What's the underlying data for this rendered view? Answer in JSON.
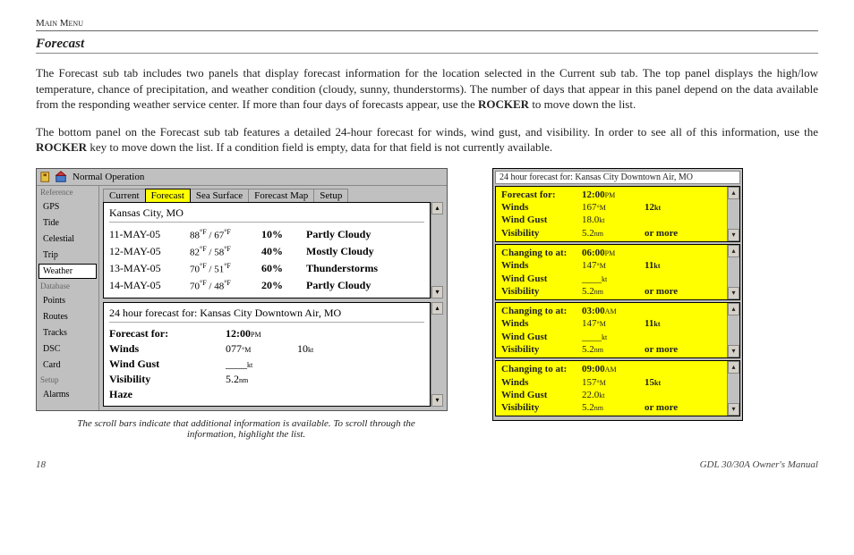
{
  "header": {
    "breadcrumb": "Main Menu"
  },
  "section": {
    "title": "Forecast",
    "para1_a": "The Forecast sub tab includes two panels that display forecast information for the location selected in the Current sub tab. The top panel displays the high/low temperature, chance of precipitation, and weather condition (cloudy, sunny, thunderstorms). The number of days that appear in this panel depend on the data available from the responding weather service center. If more than four days of forecasts appear, use the ",
    "rocker": "ROCKER",
    "para1_b": " to move down the list.",
    "para2_a": "The bottom panel on the Forecast sub tab features a detailed 24-hour forecast for winds, wind gust, and visibility. In order to see all of this information, use the ",
    "para2_b": " key to move down the list. If a condition field is empty, data for that field is not currently available."
  },
  "gps": {
    "title": "Normal Operation",
    "side_groups": {
      "g1": "Reference",
      "g2": "Database",
      "g3": "Setup"
    },
    "side_items": {
      "gps": "GPS",
      "tide": "Tide",
      "celestial": "Celestial",
      "trip": "Trip",
      "weather": "Weather",
      "points": "Points",
      "routes": "Routes",
      "tracks": "Tracks",
      "dsc": "DSC",
      "card": "Card",
      "alarms": "Alarms"
    },
    "tabs": {
      "current": "Current",
      "forecast": "Forecast",
      "sea": "Sea Surface",
      "map": "Forecast Map",
      "setup": "Setup"
    },
    "location": "Kansas City, MO",
    "daily": [
      {
        "date": "11-MAY-05",
        "hi": "88",
        "lo": "67",
        "pct": "10%",
        "cond": "Partly Cloudy"
      },
      {
        "date": "12-MAY-05",
        "hi": "82",
        "lo": "58",
        "pct": "40%",
        "cond": "Mostly Cloudy"
      },
      {
        "date": "13-MAY-05",
        "hi": "70",
        "lo": "51",
        "pct": "60%",
        "cond": "Thunderstorms"
      },
      {
        "date": "14-MAY-05",
        "hi": "70",
        "lo": "48",
        "pct": "20%",
        "cond": "Partly Cloudy"
      }
    ],
    "hourly_header": "24 hour forecast for:  Kansas City Downtown Air, MO",
    "hourly_labels": {
      "forecast": "Forecast for:",
      "winds": "Winds",
      "gust": "Wind Gust",
      "vis": "Visibility",
      "haze": "Haze"
    },
    "hourly": {
      "time": "12:00",
      "ampm": "PM",
      "wind_dir": "077",
      "wind_unit": "°M",
      "wind_spd": "10",
      "wind_spd_unit": "kt",
      "gust": "____",
      "gust_unit": "kt",
      "vis": "5.2",
      "vis_unit": "nm"
    }
  },
  "caption": "The scroll bars indicate that additional information is available. To scroll through the information, highlight the list.",
  "right": {
    "title": "24 hour forecast for:  Kansas City Downtown Air, MO",
    "labels": {
      "forecast": "Forecast for:",
      "changing": "Changing to at:",
      "winds": "Winds",
      "gust": "Wind Gust",
      "vis": "Visibility",
      "ormore": "or more"
    },
    "blocks": [
      {
        "hdr_key": "forecast",
        "time": "12:00",
        "ampm": "PM",
        "wind": "167",
        "wunit": "°M",
        "spd": "12",
        "sunit": "kt",
        "gust": "18.0",
        "gunit": "kt",
        "vis": "5.2",
        "vunit": "nm"
      },
      {
        "hdr_key": "changing",
        "time": "06:00",
        "ampm": "PM",
        "wind": "147",
        "wunit": "°M",
        "spd": "11",
        "sunit": "kt",
        "gust": "____",
        "gunit": "kt",
        "vis": "5.2",
        "vunit": "nm"
      },
      {
        "hdr_key": "changing",
        "time": "03:00",
        "ampm": "AM",
        "wind": "147",
        "wunit": "°M",
        "spd": "11",
        "sunit": "kt",
        "gust": "____",
        "gunit": "kt",
        "vis": "5.2",
        "vunit": "nm"
      },
      {
        "hdr_key": "changing",
        "time": "09:00",
        "ampm": "AM",
        "wind": "157",
        "wunit": "°M",
        "spd": "15",
        "sunit": "kt",
        "gust": "22.0",
        "gunit": "kt",
        "vis": "5.2",
        "vunit": "nm"
      }
    ]
  },
  "footer": {
    "page": "18",
    "manual": "GDL 30/30A Owner's Manual"
  }
}
